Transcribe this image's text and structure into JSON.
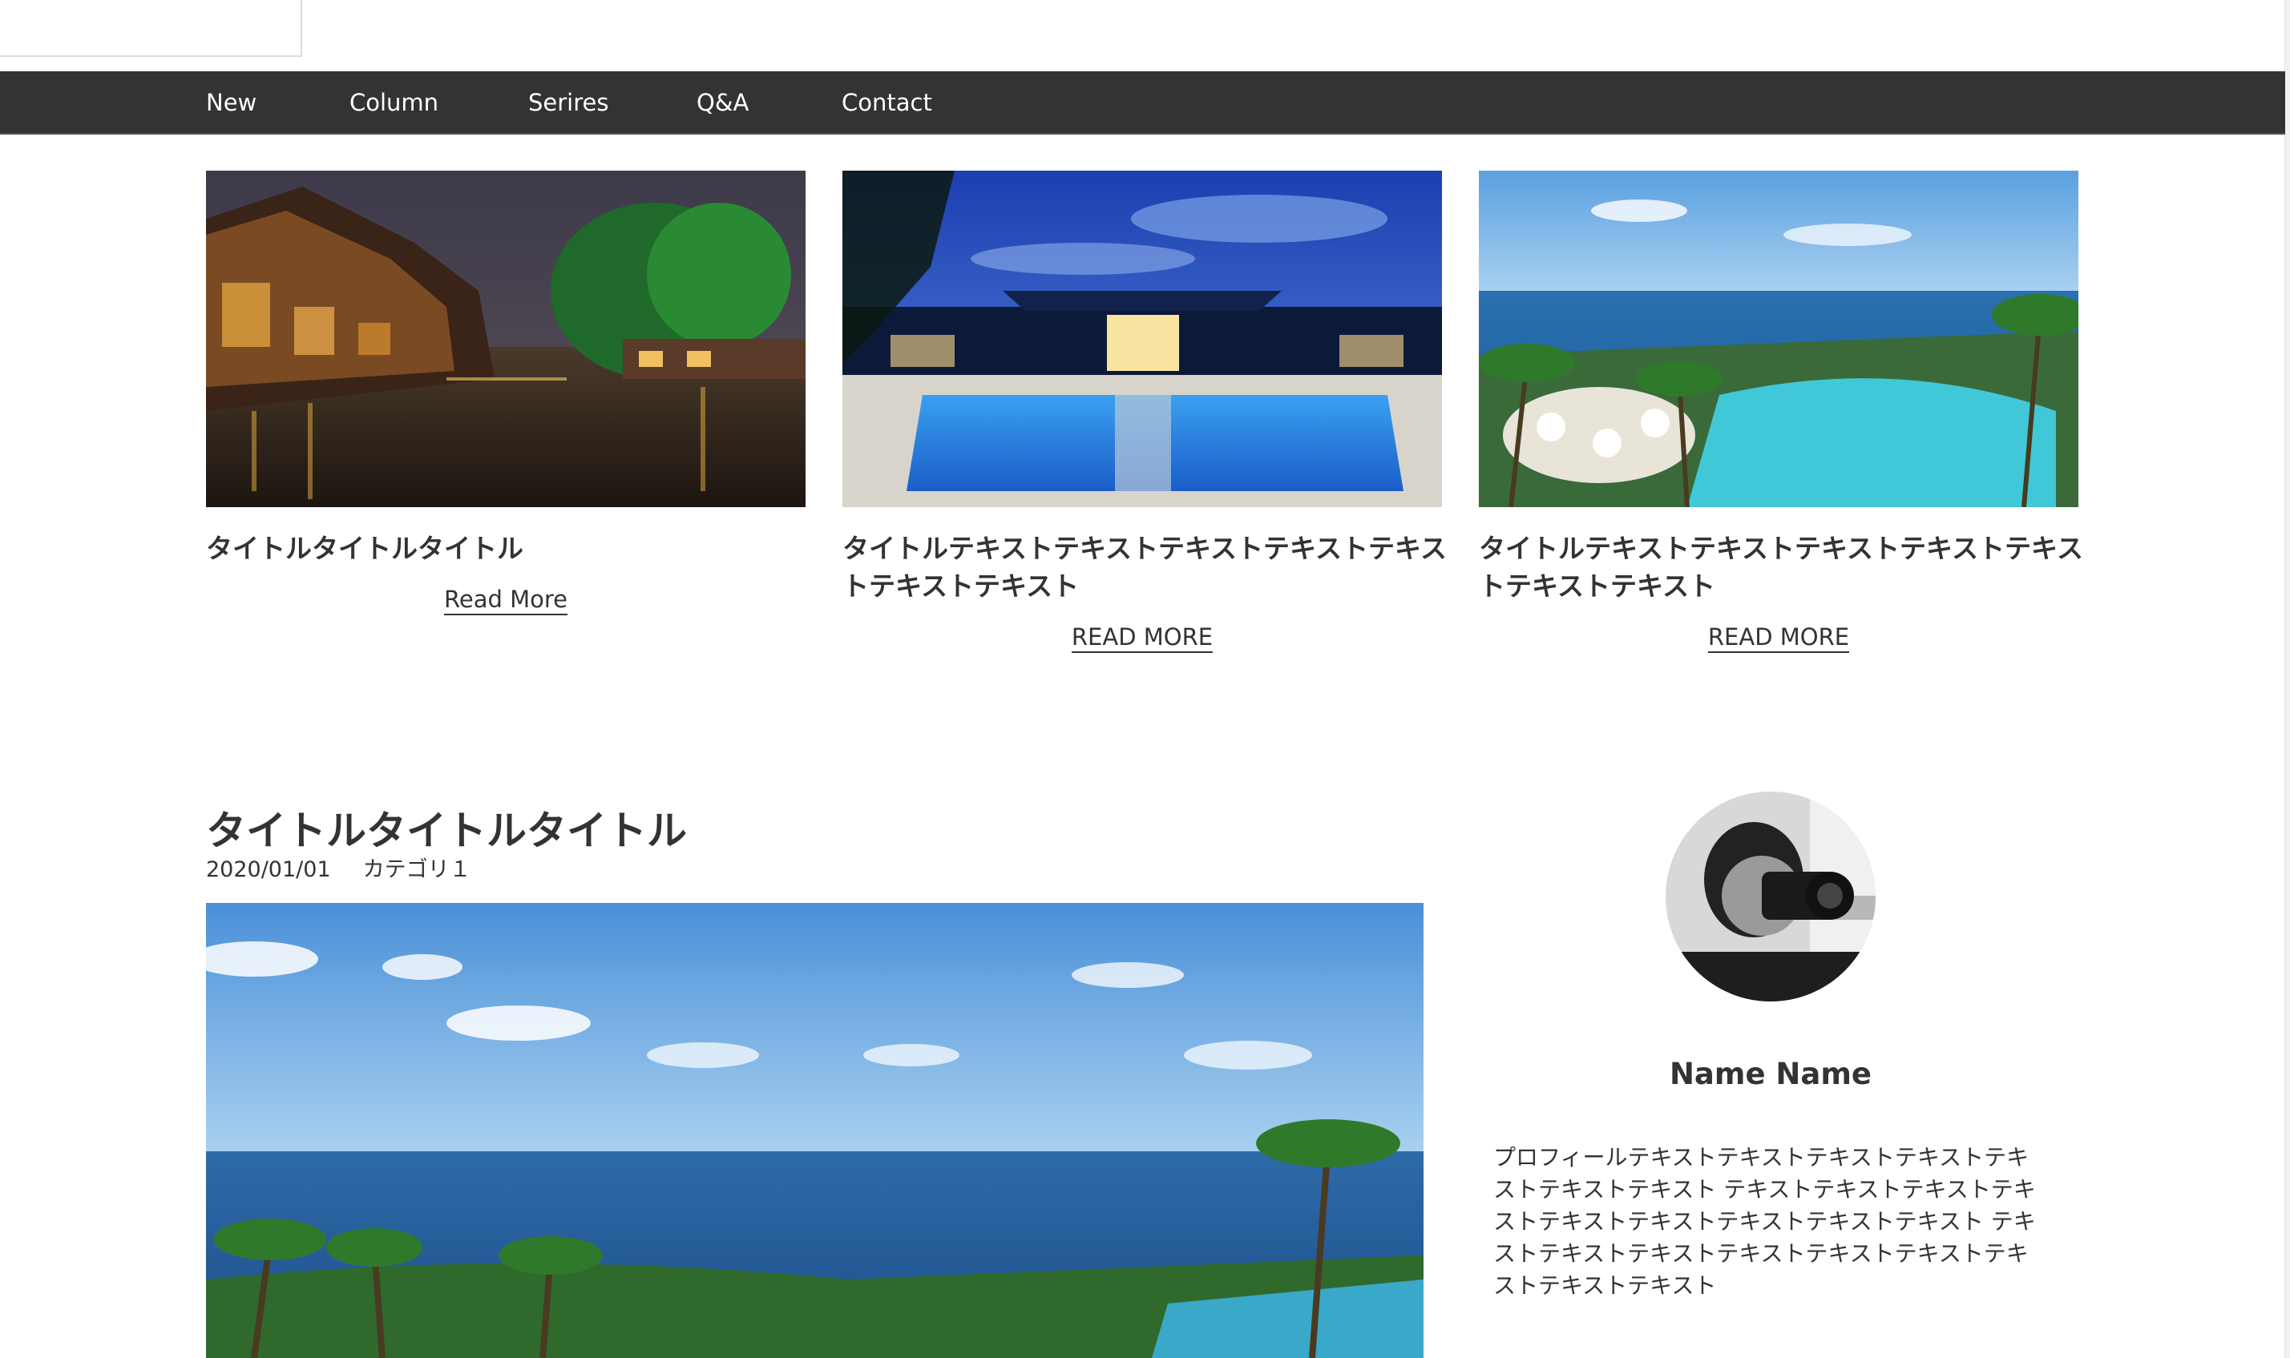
{
  "nav": {
    "items": [
      {
        "label": "New"
      },
      {
        "label": "Column"
      },
      {
        "label": "Serires"
      },
      {
        "label": "Q&A"
      },
      {
        "label": "Contact"
      }
    ]
  },
  "cards": [
    {
      "title_lines": [
        "タイトルタイトルタイトル"
      ],
      "read_more": "Read More",
      "image": "night-canal-town-photo"
    },
    {
      "title_lines": [
        "タイトルテキストテキストテキストテキストテキス",
        "トテキストテキスト"
      ],
      "read_more": "READ MORE",
      "image": "resort-pool-night-photo"
    },
    {
      "title_lines": [
        "タイトルテキストテキストテキストテキストテキス",
        "トテキストテキスト"
      ],
      "read_more": "READ MORE",
      "image": "seaside-resort-pool-photo"
    }
  ],
  "post": {
    "title": "タイトルタイトルタイトル",
    "date": "2020/01/01",
    "category": "カテゴリ１",
    "image": "ocean-palm-resort-photo"
  },
  "profile": {
    "name": "Name Name",
    "text_lines": [
      "プロフィールテキストテキストテキストテキストテキ",
      "ストテキストテキスト テキストテキストテキストテキ",
      "ストテキストテキストテキストテキストテキスト テキ",
      "ストテキストテキストテキストテキストテキストテキ",
      "ストテキストテキスト"
    ],
    "avatar": "photographer-avatar"
  },
  "colors": {
    "navbar": "#333333",
    "nav_text": "#ffffff",
    "text": "#333333"
  }
}
